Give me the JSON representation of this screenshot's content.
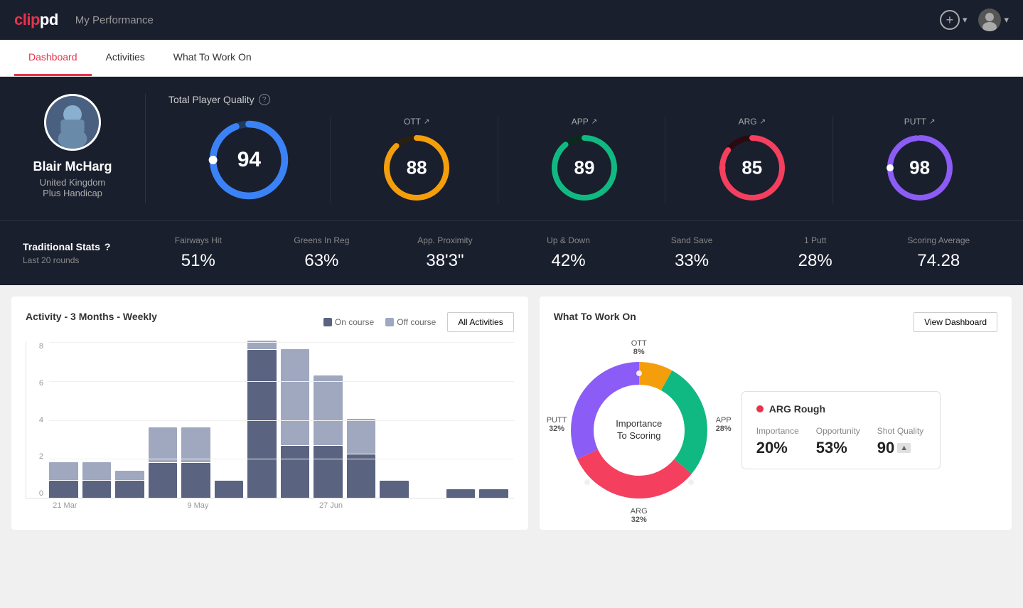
{
  "header": {
    "logo": "clippd",
    "title": "My Performance",
    "add_label": "",
    "profile_label": ""
  },
  "tabs": [
    {
      "id": "dashboard",
      "label": "Dashboard",
      "active": true
    },
    {
      "id": "activities",
      "label": "Activities",
      "active": false
    },
    {
      "id": "what-to-work-on",
      "label": "What To Work On",
      "active": false
    }
  ],
  "player": {
    "name": "Blair McHarg",
    "country": "United Kingdom",
    "handicap": "Plus Handicap"
  },
  "quality": {
    "title": "Total Player Quality",
    "main": {
      "value": 94,
      "color": "#3b82f6",
      "bg_color": "#1e3a5f",
      "pct": 94
    },
    "metrics": [
      {
        "label": "OTT",
        "value": 88,
        "color": "#f59e0b",
        "pct": 88
      },
      {
        "label": "APP",
        "value": 89,
        "color": "#10b981",
        "pct": 89
      },
      {
        "label": "ARG",
        "value": 85,
        "color": "#f43f5e",
        "pct": 85
      },
      {
        "label": "PUTT",
        "value": 98,
        "color": "#8b5cf6",
        "pct": 98
      }
    ]
  },
  "traditional_stats": {
    "title": "Traditional Stats",
    "subtitle": "Last 20 rounds",
    "items": [
      {
        "label": "Fairways Hit",
        "value": "51%"
      },
      {
        "label": "Greens In Reg",
        "value": "63%"
      },
      {
        "label": "App. Proximity",
        "value": "38'3\""
      },
      {
        "label": "Up & Down",
        "value": "42%"
      },
      {
        "label": "Sand Save",
        "value": "33%"
      },
      {
        "label": "1 Putt",
        "value": "28%"
      },
      {
        "label": "Scoring Average",
        "value": "74.28"
      }
    ]
  },
  "activity_chart": {
    "title": "Activity - 3 Months - Weekly",
    "legend": {
      "on_course": "On course",
      "off_course": "Off course"
    },
    "button": "All Activities",
    "y_labels": [
      "8",
      "6",
      "4",
      "2",
      "0"
    ],
    "x_labels": [
      "21 Mar",
      "",
      "9 May",
      "",
      "27 Jun"
    ],
    "bars": [
      {
        "on": 1,
        "off": 1
      },
      {
        "on": 1,
        "off": 1
      },
      {
        "on": 1,
        "off": 0.5
      },
      {
        "on": 2,
        "off": 2
      },
      {
        "on": 2,
        "off": 2
      },
      {
        "on": 1,
        "off": 0
      },
      {
        "on": 8.5,
        "off": 0.5
      },
      {
        "on": 3,
        "off": 5.5
      },
      {
        "on": 3,
        "off": 4
      },
      {
        "on": 2.5,
        "off": 2
      },
      {
        "on": 1,
        "off": 0
      },
      {
        "on": 0,
        "off": 0
      },
      {
        "on": 0.5,
        "off": 0
      },
      {
        "on": 0.5,
        "off": 0
      }
    ]
  },
  "what_to_work_on": {
    "title": "What To Work On",
    "button": "View Dashboard",
    "donut": {
      "segments": [
        {
          "label": "OTT",
          "pct": 8,
          "color": "#f59e0b",
          "text_pct": "8%"
        },
        {
          "label": "APP",
          "pct": 28,
          "color": "#10b981",
          "text_pct": "28%"
        },
        {
          "label": "ARG",
          "pct": 32,
          "color": "#f43f5e",
          "text_pct": "32%"
        },
        {
          "label": "PUTT",
          "pct": 32,
          "color": "#8b5cf6",
          "text_pct": "32%"
        }
      ],
      "center_line1": "Importance",
      "center_line2": "To Scoring"
    },
    "card": {
      "title": "ARG Rough",
      "dot_color": "#e8334a",
      "metrics": [
        {
          "label": "Importance",
          "value": "20%"
        },
        {
          "label": "Opportunity",
          "value": "53%"
        },
        {
          "label": "Shot Quality",
          "value": "90",
          "badge": "▲"
        }
      ]
    }
  },
  "colors": {
    "dark_bg": "#1a1f2e",
    "accent_red": "#e8334a",
    "on_course": "#5a6380",
    "off_course": "#a0a8bf"
  }
}
